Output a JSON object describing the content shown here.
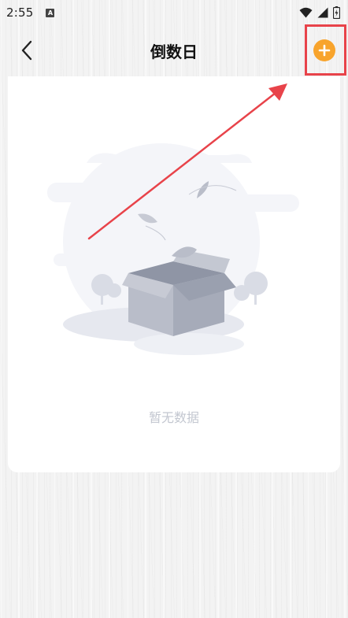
{
  "status_bar": {
    "time": "2:55",
    "app_icon_letter": "A",
    "icons": [
      "wifi-icon",
      "signal-icon",
      "battery-icon"
    ]
  },
  "header": {
    "title": "倒数日",
    "back_icon": "back-arrow-icon",
    "add_icon": "plus-circle-icon",
    "add_color": "#f8a42c"
  },
  "main": {
    "empty_text": "暂无数据",
    "illustration": "empty-box-icon"
  },
  "annotation": {
    "highlight_color": "#e8434a",
    "arrow_color": "#e8434a"
  }
}
